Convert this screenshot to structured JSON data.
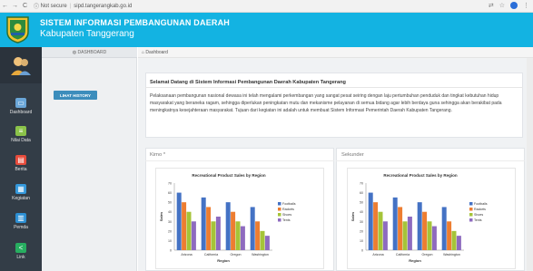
{
  "browser": {
    "back": "←",
    "forward": "→",
    "reload": "C",
    "secure_label": "Not secure",
    "url": "sipd.tangerangkab.go.id"
  },
  "header": {
    "title": "SISTEM INFORMASI PEMBANGUNAN DAERAH",
    "subtitle": "Kabupaten Tanggerang"
  },
  "sidebar": {
    "items": [
      {
        "label": "Dashboard",
        "icon": "monitor-icon",
        "color": "#6aa6d8"
      },
      {
        "label": "Nilai Data",
        "icon": "database-icon",
        "color": "#8bc34a"
      },
      {
        "label": "Berita",
        "icon": "news-icon",
        "color": "#e74c3c"
      },
      {
        "label": "Kegiatan",
        "icon": "calendar-icon",
        "color": "#3498db"
      },
      {
        "label": "Pemda",
        "icon": "building-icon",
        "color": "#2c8fd3"
      },
      {
        "label": "Link",
        "icon": "share-icon",
        "color": "#27ae60"
      }
    ]
  },
  "col2": {
    "tab_label": "DASHBOARD",
    "history_button": "LIHAT HISTORY"
  },
  "breadcrumb": "Dashboard",
  "welcome": {
    "title": "Selamat Datang di Sistem Informasi Pembangunan Daerah Kabupaten Tangerang",
    "text": "Pelaksanaan pembangunan nasional dewasa ini telah mengalami perkembangan yang sangat pesat seiring dengan laju pertumbuhan penduduk dan tingkat kebutuhan hidup masyarakat yang beraneka ragam, sehingga diperlukan peningkatan mutu dan mekanisme pelayanan di semua bidang agar lebih berdaya guna sehingga akan berakibat pada meningkatnya kesejahteraan masyarakat. Tujuan dari kegiatan ini adalah untuk membuat Sistem Informasi Pemerintah Daerah Kabupaten Tangerang."
  },
  "panels": [
    {
      "title": "Kimo *"
    },
    {
      "title": "Sekunder"
    }
  ],
  "colors": {
    "header": "#13b3e2",
    "sidebar": "#333d47",
    "button": "#3c8dbc"
  },
  "chart_data": [
    {
      "type": "bar",
      "title": "Recreational Product Sales by Region",
      "xlabel": "Region",
      "ylabel": "Sales",
      "ylim": [
        0,
        70
      ],
      "yticks": [
        0,
        10,
        20,
        30,
        40,
        50,
        60,
        70
      ],
      "categories": [
        "Arizona",
        "California",
        "Oregon",
        "Washington"
      ],
      "series": [
        {
          "name": "Footballs",
          "color": "#4472c4",
          "values": [
            60,
            55,
            50,
            45
          ]
        },
        {
          "name": "Rackets",
          "color": "#ed7d31",
          "values": [
            50,
            45,
            40,
            30
          ]
        },
        {
          "name": "Shoes",
          "color": "#a5c438",
          "values": [
            40,
            30,
            30,
            20
          ]
        },
        {
          "name": "Tents",
          "color": "#8e6bbf",
          "values": [
            30,
            35,
            25,
            15
          ]
        }
      ],
      "legend": "right",
      "grid": false
    },
    {
      "type": "bar",
      "title": "Recreational Product Sales by Region",
      "xlabel": "Region",
      "ylabel": "Sales",
      "ylim": [
        0,
        70
      ],
      "yticks": [
        0,
        10,
        20,
        30,
        40,
        50,
        60,
        70
      ],
      "categories": [
        "Arizona",
        "California",
        "Oregon",
        "Washington"
      ],
      "series": [
        {
          "name": "Footballs",
          "color": "#4472c4",
          "values": [
            60,
            55,
            50,
            45
          ]
        },
        {
          "name": "Rackets",
          "color": "#ed7d31",
          "values": [
            50,
            45,
            40,
            30
          ]
        },
        {
          "name": "Shoes",
          "color": "#a5c438",
          "values": [
            40,
            30,
            30,
            20
          ]
        },
        {
          "name": "Tents",
          "color": "#8e6bbf",
          "values": [
            30,
            35,
            25,
            15
          ]
        }
      ],
      "legend": "right",
      "grid": false
    }
  ]
}
